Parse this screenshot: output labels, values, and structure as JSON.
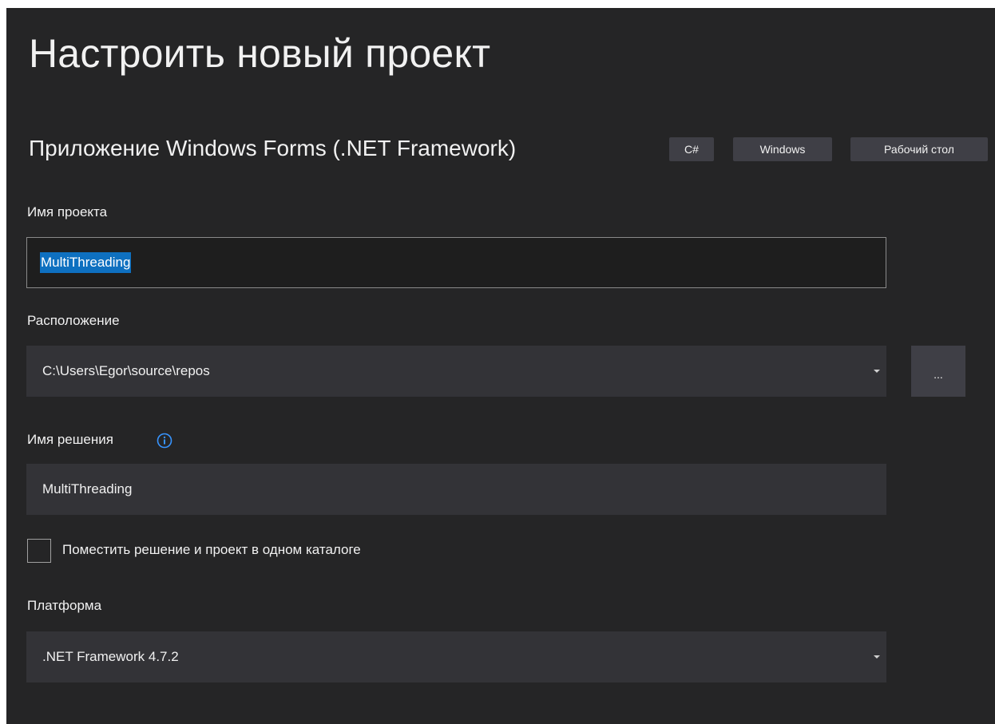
{
  "header": {
    "title": "Настроить новый проект",
    "template_name": "Приложение Windows Forms (.NET Framework)",
    "tags": [
      "C#",
      "Windows",
      "Рабочий стол"
    ]
  },
  "form": {
    "project_name": {
      "label": "Имя проекта",
      "value": "MultiThreading"
    },
    "location": {
      "label": "Расположение",
      "value": "C:\\Users\\Egor\\source\\repos",
      "browse_label": "..."
    },
    "solution_name": {
      "label": "Имя решения",
      "value": "MultiThreading",
      "info_icon": "info-icon"
    },
    "same_directory": {
      "label": "Поместить решение и проект в одном каталоге",
      "checked": false
    },
    "platform": {
      "label": "Платформа",
      "value": ".NET Framework 4.7.2"
    }
  },
  "colors": {
    "background": "#252526",
    "field_background": "#333337",
    "selection": "#0e70c0",
    "accent": "#3794ff"
  }
}
